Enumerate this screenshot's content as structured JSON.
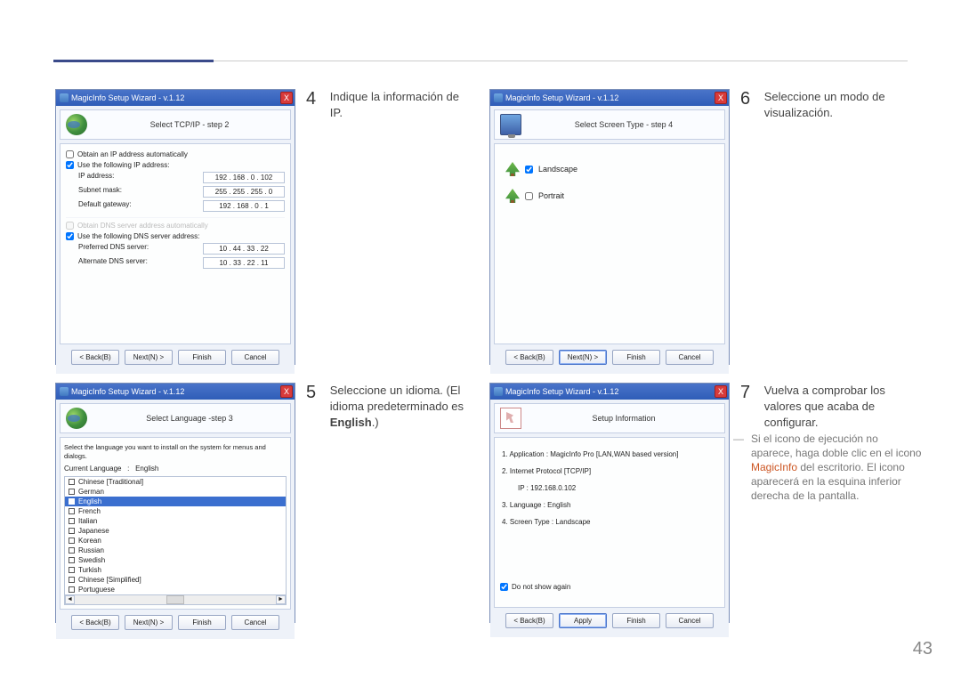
{
  "page_number": "43",
  "wizard_title": "MagicInfo Setup Wizard - v.1.12",
  "close_x": "X",
  "buttons": {
    "back": "< Back(B)",
    "next": "Next(N) >",
    "finish": "Finish",
    "cancel": "Cancel",
    "apply": "Apply"
  },
  "step4": {
    "num": "4",
    "desc": "Indique la información de IP.",
    "header": "Select TCP/IP - step 2",
    "auto_ip": "Obtain an IP address automatically",
    "use_ip": "Use the following IP address:",
    "ip_label": "IP address:",
    "ip_val": "192 . 168 .  0  . 102",
    "mask_label": "Subnet mask:",
    "mask_val": "255 . 255 . 255 .  0",
    "gw_label": "Default gateway:",
    "gw_val": "192 . 168 .  0  .  1",
    "auto_dns": "Obtain DNS server address automatically",
    "use_dns": "Use the following DNS server address:",
    "pref_label": "Preferred DNS server:",
    "pref_val": "10 . 44 . 33 . 22",
    "alt_label": "Alternate DNS server:",
    "alt_val": "10 . 33 . 22 . 11"
  },
  "step5": {
    "num": "5",
    "desc_a": "Seleccione un idioma. (El idioma predeterminado es ",
    "desc_bold": "English",
    "desc_b": ".)",
    "header": "Select Language -step 3",
    "intro": "Select the language you want to install on the system for menus and dialogs.",
    "current_label": "Current Language",
    "current_sep": ":",
    "current_val": "English",
    "languages": [
      "Chinese [Traditional]",
      "German",
      "English",
      "French",
      "Italian",
      "Japanese",
      "Korean",
      "Russian",
      "Swedish",
      "Turkish",
      "Chinese [Simplified]",
      "Portuguese"
    ],
    "selected_index": 2
  },
  "step6": {
    "num": "6",
    "desc": "Seleccione un modo de visualización.",
    "header": "Select Screen Type - step 4",
    "landscape": "Landscape",
    "portrait": "Portrait"
  },
  "step7": {
    "num": "7",
    "desc": "Vuelva a comprobar los valores que acaba de configurar.",
    "header": "Setup Information",
    "l1": "1. Application :    MagicInfo Pro [LAN,WAN based version]",
    "l2": "2. Internet Protocol [TCP/IP]",
    "l2_sub": "IP :    192.168.0.102",
    "l3": "3. Language :    English",
    "l4": "4. Screen Type :    Landscape",
    "do_not_show": "Do not show again"
  },
  "note": {
    "a": "Si el icono de ejecución no aparece, haga doble clic en el icono ",
    "highlight": "MagicInfo",
    "b": " del escritorio. El icono aparecerá en la esquina inferior derecha de la pantalla."
  }
}
